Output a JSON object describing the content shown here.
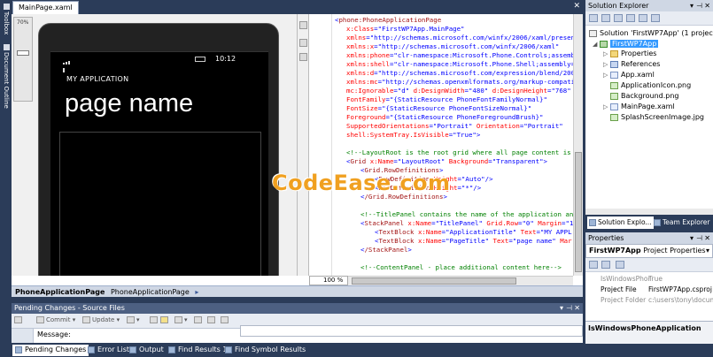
{
  "left_strip": {
    "toolbox": "Toolbox",
    "document_outline": "Document Outline"
  },
  "document": {
    "tab_label": "MainPage.xaml",
    "designer": {
      "zoom_label": "70%",
      "zoom_level": 0.35,
      "phone_clock": "10:12",
      "app_title": "MY APPLICATION",
      "page_title": "page name"
    },
    "xaml_zoom": "100 %"
  },
  "watermark": "CodeEase.com",
  "breadcrumb": {
    "item1": "PhoneApplicationPage",
    "item2": "PhoneApplicationPage"
  },
  "pending_changes": {
    "title": "Pending Changes - Source Files",
    "toolbar": {
      "commit": "Commit",
      "update": "Update"
    },
    "message_label": "Message:"
  },
  "bottom_tabs": {
    "pending": "Pending Changes",
    "errors": "Error List",
    "output": "Output",
    "find1": "Find Results 1",
    "find_symbol": "Find Symbol Results"
  },
  "solution_explorer": {
    "title": "Solution Explorer",
    "solution": "Solution 'FirstWP7App' (1 project)",
    "project": "FirstWP7App",
    "items": [
      "Properties",
      "References",
      "App.xaml",
      "ApplicationIcon.png",
      "Background.png",
      "MainPage.xaml",
      "SplashScreenImage.jpg"
    ],
    "tabs": {
      "sol": "Solution Explo...",
      "team": "Team Explorer"
    }
  },
  "properties": {
    "title": "Properties",
    "selector_name": "FirstWP7App",
    "selector_type": "Project Properties",
    "rows": [
      {
        "key": "IsWindowsPhor",
        "value": "True"
      },
      {
        "key": "Project File",
        "value": "FirstWP7App.csproj"
      },
      {
        "key": "Project Folder",
        "value": "c:\\users\\tony\\docum"
      }
    ],
    "description": "IsWindowsPhoneApplication"
  },
  "code": {
    "l1_tag": "phone:PhoneApplicationPage",
    "l2_attr": "x:Class",
    "l2_val": "\"FirstWP7App.MainPage\"",
    "l3_attr": "xmlns",
    "l3_val": "\"http://schemas.microsoft.com/winfx/2006/xaml/presen",
    "l4_attr": "xmlns:x",
    "l4_val": "\"http://schemas.microsoft.com/winfx/2006/xaml\"",
    "l5_attr": "xmlns:phone",
    "l5_val": "\"clr-namespace:Microsoft.Phone.Controls;assemb",
    "l6_attr": "xmlns:shell",
    "l6_val": "\"clr-namespace:Microsoft.Phone.Shell;assembly=",
    "l7_attr": "xmlns:d",
    "l7_val": "\"http://schemas.microsoft.com/expression/blend/200",
    "l8_attr": "xmlns:mc",
    "l8_val": "\"http://schemas.openxmlformats.org/markup-compati",
    "l9_attr1": "mc:Ignorable",
    "l9_val1": "\"d\"",
    "l9_attr2": "d:DesignWidth",
    "l9_val2": "\"480\"",
    "l9_attr3": "d:DesignHeight",
    "l9_val3": "\"768\"",
    "l10_attr": "FontFamily",
    "l10_val": "\"{StaticResource PhoneFontFamilyNormal}\"",
    "l11_attr": "FontSize",
    "l11_val": "\"{StaticResource PhoneFontSizeNormal}\"",
    "l12_attr": "Foreground",
    "l12_val": "\"{StaticResource PhoneForegroundBrush}\"",
    "l13_attr1": "SupportedOrientations",
    "l13_val1": "\"Portrait\"",
    "l13_attr2": "Orientation",
    "l13_val2": "\"Portrait\"",
    "l14_attr": "shell:SystemTray.IsVisible",
    "l14_val": "\"True\"",
    "l15_cmt": "<!--LayoutRoot is the root grid where all page content is",
    "l16_tag": "Grid",
    "l16_attr1": "x:Name",
    "l16_val1": "\"LayoutRoot\"",
    "l16_attr2": "Background",
    "l16_val2": "\"Transparent\"",
    "l17_tag": "Grid.RowDefinitions",
    "l18_tag": "RowDefinition",
    "l18_attr": "Height",
    "l18_val": "\"Auto\"",
    "l19_tag": "RowDefinition",
    "l19_attr": "Height",
    "l19_val": "\"*\"",
    "l20_tag": "/Grid.RowDefinitions",
    "l21_cmt": "<!--TitlePanel contains the name of the application an",
    "l22_tag": "StackPanel",
    "l22_attr1": "x:Name",
    "l22_val1": "\"TitlePanel\"",
    "l22_attr2": "Grid.Row",
    "l22_val2": "\"0\"",
    "l22_attr3": "Margin",
    "l22_val3": "\"1",
    "l23_tag": "TextBlock",
    "l23_attr1": "x:Name",
    "l23_val1": "\"ApplicationTitle\"",
    "l23_attr2": "Text",
    "l23_val2": "\"MY APPL",
    "l24_tag": "TextBlock",
    "l24_attr1": "x:Name",
    "l24_val1": "\"PageTitle\"",
    "l24_attr2": "Text",
    "l24_val2": "\"page name\"",
    "l24_attr3": "Mar",
    "l25_tag": "/StackPanel",
    "l26_cmt": "<!--ContentPanel - place additional content here-->"
  }
}
